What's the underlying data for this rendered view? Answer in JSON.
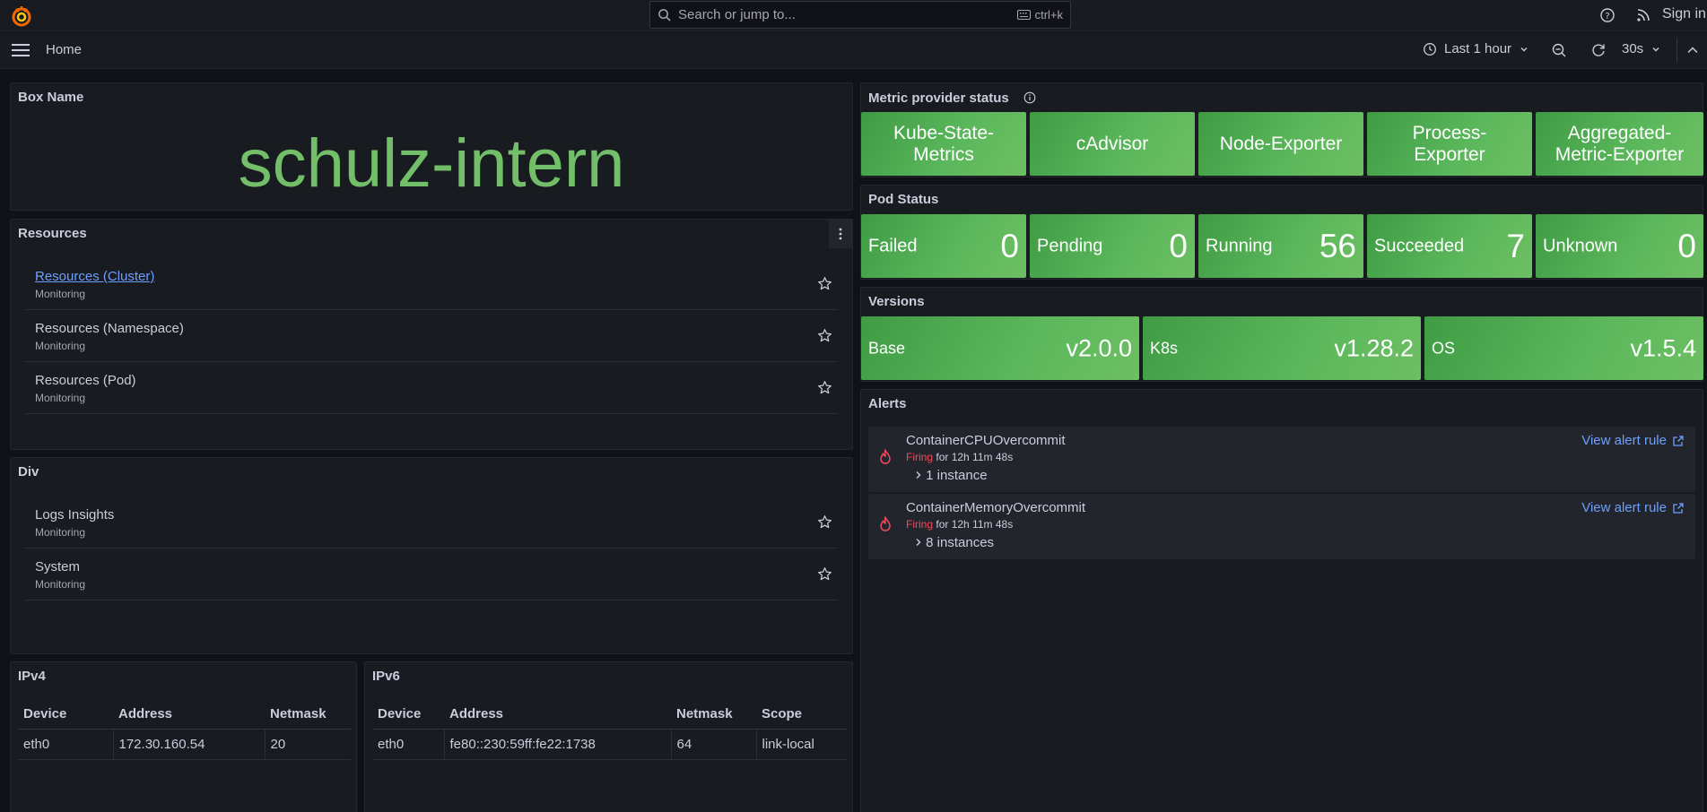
{
  "topbar": {
    "search_placeholder": "Search or jump to...",
    "shortcut": "ctrl+k",
    "signin": "Sign in",
    "brand_color": "#f46800"
  },
  "navbar": {
    "breadcrumb": "Home",
    "time_range": "Last 1 hour",
    "refresh_interval": "30s"
  },
  "box_name": {
    "title": "Box Name",
    "value": "schulz-intern"
  },
  "resources": {
    "title": "Resources",
    "items": [
      {
        "name": "Resources (Cluster)",
        "folder": "Monitoring"
      },
      {
        "name": "Resources (Namespace)",
        "folder": "Monitoring"
      },
      {
        "name": "Resources (Pod)",
        "folder": "Monitoring"
      }
    ]
  },
  "div": {
    "title": "Div",
    "items": [
      {
        "name": "Logs Insights",
        "folder": "Monitoring"
      },
      {
        "name": "System",
        "folder": "Monitoring"
      }
    ]
  },
  "ipv4": {
    "title": "IPv4",
    "columns": [
      "Device",
      "Address",
      "Netmask"
    ],
    "rows": [
      [
        "eth0",
        "172.30.160.54",
        "20"
      ]
    ]
  },
  "ipv6": {
    "title": "IPv6",
    "columns": [
      "Device",
      "Address",
      "Netmask",
      "Scope"
    ],
    "rows": [
      [
        "eth0",
        "fe80::230:59ff:fe22:1738",
        "64",
        "link-local"
      ]
    ]
  },
  "metric_provider": {
    "title": "Metric provider status",
    "tiles": [
      {
        "l1": "Kube-State-",
        "l2": "Metrics"
      },
      {
        "l1": "cAdvisor",
        "l2": ""
      },
      {
        "l1": "Node-Exporter",
        "l2": ""
      },
      {
        "l1": "Process-",
        "l2": "Exporter"
      },
      {
        "l1": "Aggregated-",
        "l2": "Metric-Exporter"
      }
    ]
  },
  "pod_status": {
    "title": "Pod Status",
    "tiles": [
      {
        "label": "Failed",
        "value": "0"
      },
      {
        "label": "Pending",
        "value": "0"
      },
      {
        "label": "Running",
        "value": "56"
      },
      {
        "label": "Succeeded",
        "value": "7"
      },
      {
        "label": "Unknown",
        "value": "0"
      }
    ]
  },
  "versions": {
    "title": "Versions",
    "tiles": [
      {
        "label": "Base",
        "value": "v2.0.0"
      },
      {
        "label": "K8s",
        "value": "v1.28.2"
      },
      {
        "label": "OS",
        "value": "v1.5.4"
      }
    ]
  },
  "alerts": {
    "title": "Alerts",
    "items": [
      {
        "name": "ContainerCPUOvercommit",
        "state": "Firing",
        "duration": "for 12h 11m 48s",
        "instances": "1 instance",
        "link": "View alert rule"
      },
      {
        "name": "ContainerMemoryOvercommit",
        "state": "Firing",
        "duration": "for 12h 11m 48s",
        "instances": "8 instances",
        "link": "View alert rule"
      }
    ]
  },
  "colors": {
    "accent_green": "#73bf69",
    "tile_green": "#56a64b",
    "link_blue": "#6e9fff",
    "firing_red": "#f2495c"
  }
}
